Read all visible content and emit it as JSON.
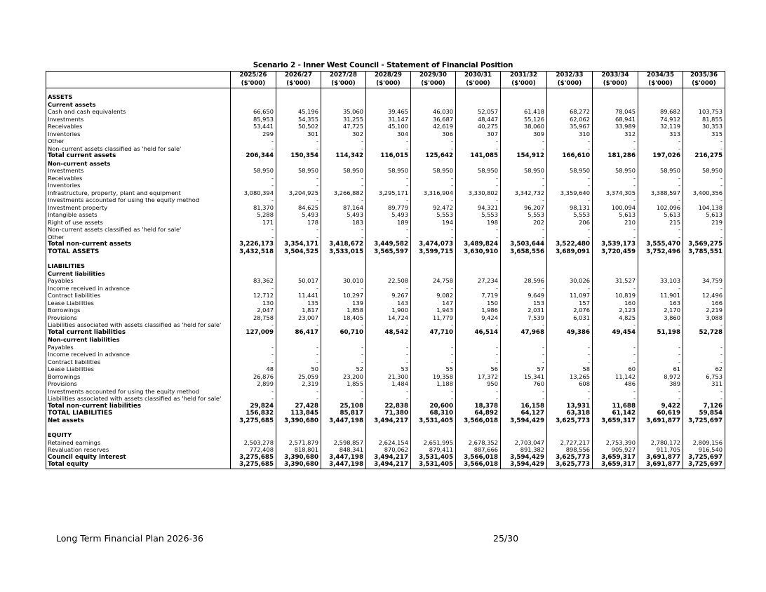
{
  "title": "Scenario 2 - Inner West Council - Statement of Financial Position",
  "columns": [
    "2025/26",
    "2026/27",
    "2027/28",
    "2028/29",
    "2029/30",
    "2030/31",
    "2031/32",
    "2032/33",
    "2033/34",
    "2034/35",
    "2035/36"
  ],
  "unit": "($'000)",
  "rows": [
    {
      "type": "gap"
    },
    {
      "type": "section",
      "label": "ASSETS"
    },
    {
      "type": "sub",
      "label": "Current assets"
    },
    {
      "type": "item",
      "label": "Cash and cash equivalents",
      "values": [
        "66,650",
        "45,196",
        "35,060",
        "39,465",
        "46,030",
        "52,057",
        "61,418",
        "68,272",
        "78,045",
        "89,682",
        "103,753"
      ]
    },
    {
      "type": "item",
      "label": "Investments",
      "values": [
        "85,953",
        "54,355",
        "31,255",
        "31,147",
        "36,687",
        "48,447",
        "55,126",
        "62,062",
        "68,941",
        "74,912",
        "81,855"
      ]
    },
    {
      "type": "item",
      "label": "Receivables",
      "values": [
        "53,441",
        "50,502",
        "47,725",
        "45,100",
        "42,619",
        "40,275",
        "38,060",
        "35,967",
        "33,989",
        "32,119",
        "30,353"
      ]
    },
    {
      "type": "item",
      "label": "Inventories",
      "values": [
        "299",
        "301",
        "302",
        "304",
        "306",
        "307",
        "309",
        "310",
        "312",
        "313",
        "315"
      ]
    },
    {
      "type": "item",
      "label": "Other",
      "values": [
        "-",
        "-",
        "-",
        "-",
        "-",
        "-",
        "-",
        "-",
        "-",
        "-",
        "-"
      ]
    },
    {
      "type": "item",
      "label": "Non-current assets classified as 'held for sale'",
      "values": [
        "-",
        "-",
        "-",
        "-",
        "-",
        "-",
        "-",
        "-",
        "-",
        "-",
        "-"
      ]
    },
    {
      "type": "total",
      "label": "Total current assets",
      "values": [
        "206,344",
        "150,354",
        "114,342",
        "116,015",
        "125,642",
        "141,085",
        "154,912",
        "166,610",
        "181,286",
        "197,026",
        "216,275"
      ]
    },
    {
      "type": "sub",
      "label": "Non-current assets"
    },
    {
      "type": "item",
      "label": "Investments",
      "values": [
        "58,950",
        "58,950",
        "58,950",
        "58,950",
        "58,950",
        "58,950",
        "58,950",
        "58,950",
        "58,950",
        "58,950",
        "58,950"
      ]
    },
    {
      "type": "item",
      "label": "Receivables",
      "values": [
        "-",
        "-",
        "-",
        "-",
        "-",
        "-",
        "-",
        "-",
        "-",
        "-",
        "-"
      ]
    },
    {
      "type": "item",
      "label": "Inventories",
      "values": [
        "-",
        "-",
        "-",
        "-",
        "-",
        "-",
        "-",
        "-",
        "-",
        "-",
        "-"
      ]
    },
    {
      "type": "item",
      "label": "Infrastructure, property, plant and equipment",
      "values": [
        "3,080,394",
        "3,204,925",
        "3,266,882",
        "3,295,171",
        "3,316,904",
        "3,330,802",
        "3,342,732",
        "3,359,640",
        "3,374,305",
        "3,388,597",
        "3,400,356"
      ]
    },
    {
      "type": "item",
      "label": "Investments accounted for using the equity method",
      "values": [
        "-",
        "-",
        "-",
        "-",
        "-",
        "-",
        "-",
        "-",
        "-",
        "-",
        "-"
      ]
    },
    {
      "type": "item",
      "label": "Investment property",
      "values": [
        "81,370",
        "84,625",
        "87,164",
        "89,779",
        "92,472",
        "94,321",
        "96,207",
        "98,131",
        "100,094",
        "102,096",
        "104,138"
      ]
    },
    {
      "type": "item",
      "label": "Intangible assets",
      "values": [
        "5,288",
        "5,493",
        "5,493",
        "5,493",
        "5,553",
        "5,553",
        "5,553",
        "5,553",
        "5,613",
        "5,613",
        "5,613"
      ]
    },
    {
      "type": "item",
      "label": "Right of use assets",
      "values": [
        "171",
        "178",
        "183",
        "189",
        "194",
        "198",
        "202",
        "206",
        "210",
        "215",
        "219"
      ]
    },
    {
      "type": "item",
      "label": "Non-current assets classified as 'held for sale'",
      "values": [
        "-",
        "-",
        "-",
        "-",
        "-",
        "-",
        "-",
        "-",
        "-",
        "-",
        "-"
      ]
    },
    {
      "type": "item",
      "label": "Other",
      "values": [
        "-",
        "-",
        "-",
        "-",
        "-",
        "-",
        "-",
        "-",
        "-",
        "-",
        "-"
      ]
    },
    {
      "type": "total",
      "label": "Total non-current assets",
      "values": [
        "3,226,173",
        "3,354,171",
        "3,418,672",
        "3,449,582",
        "3,474,073",
        "3,489,824",
        "3,503,644",
        "3,522,480",
        "3,539,173",
        "3,555,470",
        "3,569,275"
      ]
    },
    {
      "type": "total big",
      "label": "TOTAL ASSETS",
      "values": [
        "3,432,518",
        "3,504,525",
        "3,533,015",
        "3,565,597",
        "3,599,715",
        "3,630,910",
        "3,658,556",
        "3,689,091",
        "3,720,459",
        "3,752,496",
        "3,785,551"
      ]
    },
    {
      "type": "gap2"
    },
    {
      "type": "section",
      "label": "LIABILITIES"
    },
    {
      "type": "sub",
      "label": "Current liabilities"
    },
    {
      "type": "item",
      "label": "Payables",
      "values": [
        "83,362",
        "50,017",
        "30,010",
        "22,508",
        "24,758",
        "27,234",
        "28,596",
        "30,026",
        "31,527",
        "33,103",
        "34,759"
      ]
    },
    {
      "type": "item",
      "label": "Income received in advance",
      "values": [
        "-",
        "-",
        "-",
        "-",
        "-",
        "-",
        "-",
        "-",
        "-",
        "-",
        "-"
      ]
    },
    {
      "type": "item",
      "label": "Contract liabilities",
      "values": [
        "12,712",
        "11,441",
        "10,297",
        "9,267",
        "9,082",
        "7,719",
        "9,649",
        "11,097",
        "10,819",
        "11,901",
        "12,496"
      ]
    },
    {
      "type": "item",
      "label": "Lease Liabilities",
      "values": [
        "130",
        "135",
        "139",
        "143",
        "147",
        "150",
        "153",
        "157",
        "160",
        "163",
        "166"
      ]
    },
    {
      "type": "item",
      "label": "Borrowings",
      "values": [
        "2,047",
        "1,817",
        "1,858",
        "1,900",
        "1,943",
        "1,986",
        "2,031",
        "2,076",
        "2,123",
        "2,170",
        "2,219"
      ]
    },
    {
      "type": "item",
      "label": "Provisions",
      "values": [
        "28,758",
        "23,007",
        "18,405",
        "14,724",
        "11,779",
        "9,424",
        "7,539",
        "6,031",
        "4,825",
        "3,860",
        "3,088"
      ]
    },
    {
      "type": "item",
      "label": "Liabilities associated with assets classified as 'held for sale'",
      "values": [
        "-",
        "-",
        "-",
        "-",
        "-",
        "-",
        "-",
        "-",
        "-",
        "-",
        "-"
      ]
    },
    {
      "type": "total",
      "label": "Total current liabilities",
      "values": [
        "127,009",
        "86,417",
        "60,710",
        "48,542",
        "47,710",
        "46,514",
        "47,968",
        "49,386",
        "49,454",
        "51,198",
        "52,728"
      ]
    },
    {
      "type": "sub",
      "label": "Non-current liabilities"
    },
    {
      "type": "item",
      "label": "Payables",
      "values": [
        "-",
        "-",
        "-",
        "-",
        "-",
        "-",
        "-",
        "-",
        "-",
        "-",
        "-"
      ]
    },
    {
      "type": "item",
      "label": "Income received in advance",
      "values": [
        "-",
        "-",
        "-",
        "-",
        "-",
        "-",
        "-",
        "-",
        "-",
        "-",
        "-"
      ]
    },
    {
      "type": "item",
      "label": "Contract liabilities",
      "values": [
        "-",
        "-",
        "-",
        "-",
        "-",
        "-",
        "-",
        "-",
        "-",
        "-",
        "-"
      ]
    },
    {
      "type": "item",
      "label": "Lease Liabilities",
      "values": [
        "48",
        "50",
        "52",
        "53",
        "55",
        "56",
        "57",
        "58",
        "60",
        "61",
        "62"
      ]
    },
    {
      "type": "item",
      "label": "Borrowings",
      "values": [
        "26,876",
        "25,059",
        "23,200",
        "21,300",
        "19,358",
        "17,372",
        "15,341",
        "13,265",
        "11,142",
        "8,972",
        "6,753"
      ]
    },
    {
      "type": "item",
      "label": "Provisions",
      "values": [
        "2,899",
        "2,319",
        "1,855",
        "1,484",
        "1,188",
        "950",
        "760",
        "608",
        "486",
        "389",
        "311"
      ]
    },
    {
      "type": "item",
      "label": "Investments accounted for using the equity method",
      "values": [
        "-",
        "-",
        "-",
        "-",
        "-",
        "-",
        "-",
        "-",
        "-",
        "-",
        "-"
      ]
    },
    {
      "type": "item",
      "label": "Liabilities associated with assets classified as 'held for sale'",
      "values": [
        "-",
        "-",
        "-",
        "-",
        "-",
        "-",
        "-",
        "-",
        "-",
        "-",
        "-"
      ]
    },
    {
      "type": "total",
      "label": "Total non-current liabilities",
      "values": [
        "29,824",
        "27,428",
        "25,108",
        "22,838",
        "20,600",
        "18,378",
        "16,158",
        "13,931",
        "11,688",
        "9,422",
        "7,126"
      ]
    },
    {
      "type": "total big",
      "label": "TOTAL LIABILITIES",
      "values": [
        "156,832",
        "113,845",
        "85,817",
        "71,380",
        "68,310",
        "64,892",
        "64,127",
        "63,318",
        "61,142",
        "60,619",
        "59,854"
      ]
    },
    {
      "type": "total",
      "label": "Net assets",
      "values": [
        "3,275,685",
        "3,390,680",
        "3,447,198",
        "3,494,217",
        "3,531,405",
        "3,566,018",
        "3,594,429",
        "3,625,773",
        "3,659,317",
        "3,691,877",
        "3,725,697"
      ]
    },
    {
      "type": "gap2"
    },
    {
      "type": "section",
      "label": "EQUITY"
    },
    {
      "type": "item",
      "label": "Retained earnings",
      "values": [
        "2,503,278",
        "2,571,879",
        "2,598,857",
        "2,624,154",
        "2,651,995",
        "2,678,352",
        "2,703,047",
        "2,727,217",
        "2,753,390",
        "2,780,172",
        "2,809,156"
      ]
    },
    {
      "type": "item",
      "label": "Revaluation reserves",
      "values": [
        "772,408",
        "818,801",
        "848,341",
        "870,062",
        "879,411",
        "887,666",
        "891,382",
        "898,556",
        "905,927",
        "911,705",
        "916,540"
      ]
    },
    {
      "type": "total",
      "label": "Council equity interest",
      "values": [
        "3,275,685",
        "3,390,680",
        "3,447,198",
        "3,494,217",
        "3,531,405",
        "3,566,018",
        "3,594,429",
        "3,625,773",
        "3,659,317",
        "3,691,877",
        "3,725,697"
      ]
    },
    {
      "type": "total",
      "label": "Total equity",
      "values": [
        "3,275,685",
        "3,390,680",
        "3,447,198",
        "3,494,217",
        "3,531,405",
        "3,566,018",
        "3,594,429",
        "3,625,773",
        "3,659,317",
        "3,691,877",
        "3,725,697"
      ]
    }
  ],
  "footer": {
    "left": "Long Term Financial Plan 2026-36",
    "page": "25/30"
  }
}
